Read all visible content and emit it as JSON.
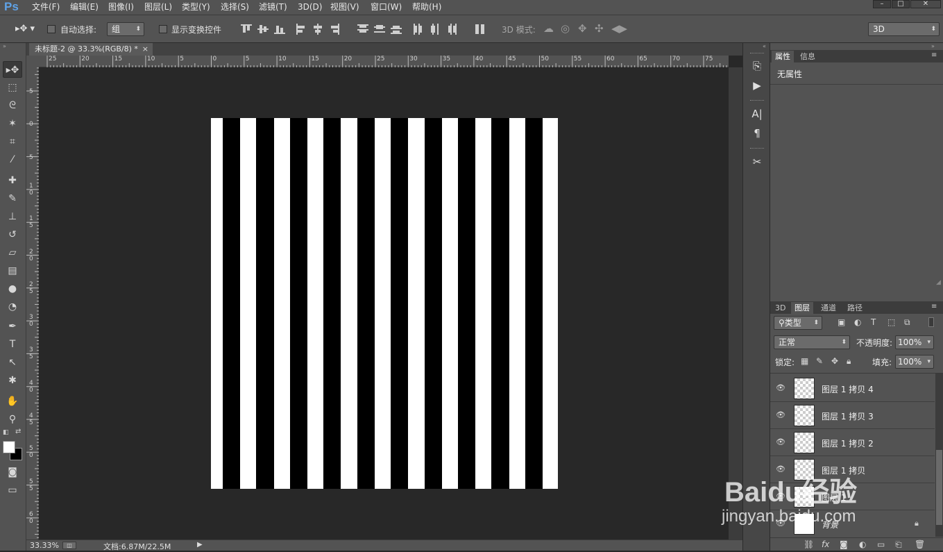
{
  "app": {
    "logo": "Ps"
  },
  "menu": [
    "文件(F)",
    "编辑(E)",
    "图像(I)",
    "图层(L)",
    "类型(Y)",
    "选择(S)",
    "滤镜(T)",
    "3D(D)",
    "视图(V)",
    "窗口(W)",
    "帮助(H)"
  ],
  "window_controls": {
    "minimize": "–",
    "maximize": "□",
    "close": "✕"
  },
  "options": {
    "auto_select_label": "自动选择:",
    "auto_select_value": "组",
    "show_transform_label": "显示变换控件",
    "mode3d_label": "3D 模式:",
    "workspace_value": "3D"
  },
  "document": {
    "tab_title": "未标题-2 @ 33.3%(RGB/8) *",
    "close": "×",
    "zoom": "33.33%",
    "doc_info": "文档:6.87M/22.5M",
    "stripe_count": 10
  },
  "rulers": {
    "h_labels": [
      "25",
      "20",
      "15",
      "10",
      "5",
      "0",
      "5",
      "10",
      "15",
      "20",
      "25",
      "30",
      "35",
      "40",
      "45",
      "50",
      "55",
      "60",
      "65",
      "70",
      "75"
    ],
    "v_labels": [
      "5",
      "0",
      "5",
      "1 0",
      "1 5",
      "2 0",
      "2 5",
      "3 0",
      "3 5",
      "4 0",
      "4 5",
      "5 0",
      "5 5",
      "6 0"
    ]
  },
  "properties_panel": {
    "tabs": [
      "属性",
      "信息"
    ],
    "content": "无属性"
  },
  "layers_panel": {
    "tabs": [
      "3D",
      "图层",
      "通道",
      "路径"
    ],
    "active_tab": "图层",
    "filter_kind": "类型",
    "blend_mode": "正常",
    "opacity_label": "不透明度:",
    "opacity_value": "100%",
    "lock_label": "锁定:",
    "fill_label": "填充:",
    "fill_value": "100%",
    "layers": [
      {
        "name": "图层 1 拷贝 4",
        "selected": true
      },
      {
        "name": "图层 1 拷贝 3",
        "selected": true
      },
      {
        "name": "图层 1 拷贝 2",
        "selected": true
      },
      {
        "name": "图层 1 拷贝",
        "selected": true
      },
      {
        "name": "图层 1",
        "selected": true
      },
      {
        "name": "背景",
        "selected": false
      }
    ]
  },
  "watermark": {
    "line1": "Baidu经验",
    "line2": "jingyan.baidu.com"
  }
}
